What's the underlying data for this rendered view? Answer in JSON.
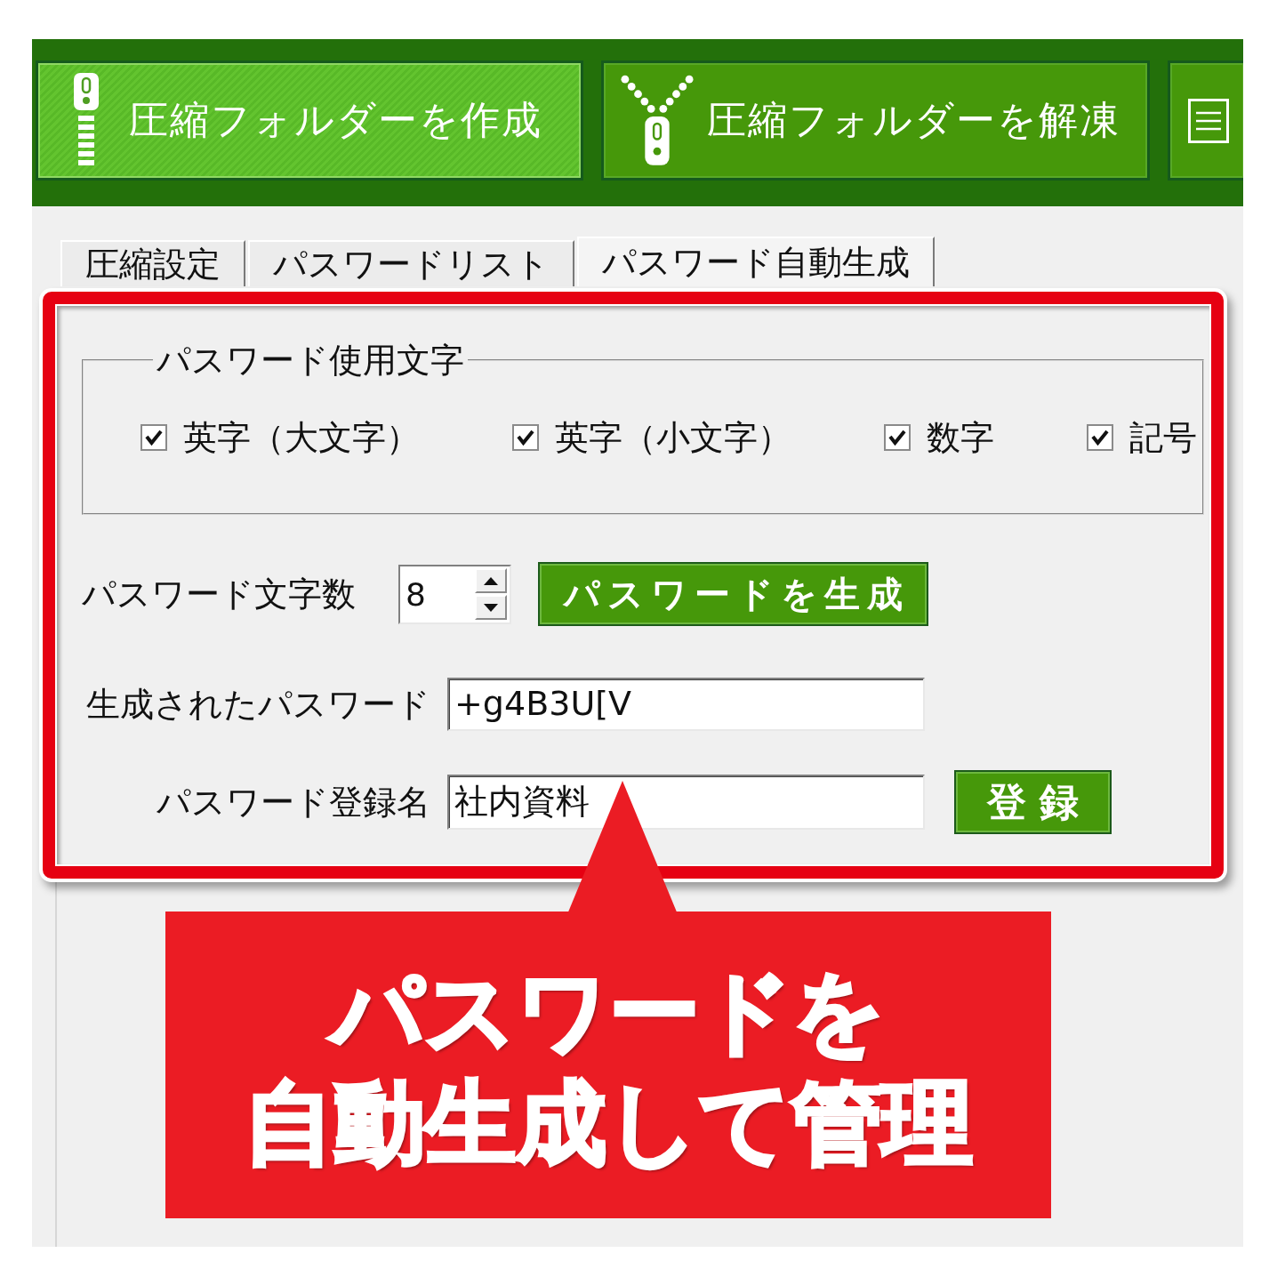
{
  "toolbar": {
    "buttons": [
      {
        "kind": "zip",
        "label": "圧縮フォルダーを作成",
        "highlighted": true
      },
      {
        "kind": "unzip",
        "label": "圧縮フォルダーを解凍",
        "highlighted": false
      },
      {
        "kind": "menu",
        "highlighted": false
      }
    ]
  },
  "tabs": [
    {
      "label": "圧縮設定",
      "selected": false
    },
    {
      "label": "パスワードリスト",
      "selected": false
    },
    {
      "label": "パスワード自動生成",
      "selected": true
    }
  ],
  "character_group": {
    "title": "パスワード使用文字",
    "options": [
      {
        "label": "英字（大文字）",
        "checked": true
      },
      {
        "label": "英字（小文字）",
        "checked": true
      },
      {
        "label": "数字",
        "checked": true
      },
      {
        "label": "記号",
        "checked": true
      }
    ]
  },
  "password_length": {
    "label": "パスワード文字数",
    "value": "8"
  },
  "generate_button": {
    "label": "パスワードを生成"
  },
  "generated_password": {
    "label": "生成されたパスワード",
    "value": "+g4B3U[V"
  },
  "registration": {
    "label": "パスワード登録名",
    "value": "社内資料",
    "button": "登 録"
  },
  "callout": {
    "lines": [
      "パスワードを",
      "自動生成して管理"
    ]
  }
}
